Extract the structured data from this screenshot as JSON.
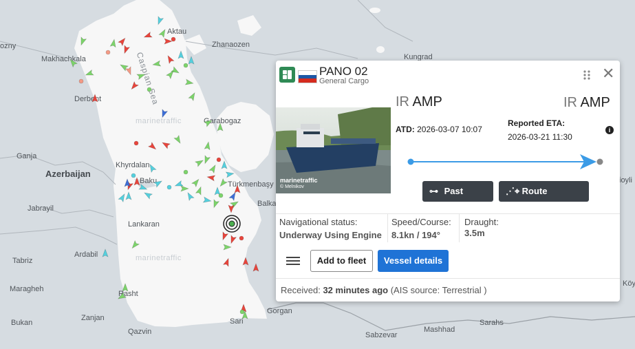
{
  "map": {
    "cities": [
      {
        "id": "aktau",
        "name": "Aktau"
      },
      {
        "id": "zhanaozen",
        "name": "Zhanaozen"
      },
      {
        "id": "kungrad",
        "name": "Kungrad"
      },
      {
        "id": "makhachkala",
        "name": "Makhachkala"
      },
      {
        "id": "derbent",
        "name": "Derbent"
      },
      {
        "id": "garabogaz",
        "name": "Garabogaz"
      },
      {
        "id": "ganja",
        "name": "Ganja"
      },
      {
        "id": "khyrdalan",
        "name": "Khyrdalan"
      },
      {
        "id": "baku",
        "name": "Baku"
      },
      {
        "id": "turkmenbasy",
        "name": "Türkmenbaşy"
      },
      {
        "id": "balkanabat",
        "name": "Balkanabat"
      },
      {
        "id": "jabrayil",
        "name": "Jabrayil"
      },
      {
        "id": "lankaran",
        "name": "Lankaran"
      },
      {
        "id": "ardabil",
        "name": "Ardabil"
      },
      {
        "id": "tabriz",
        "name": "Tabriz"
      },
      {
        "id": "maragheh",
        "name": "Maragheh"
      },
      {
        "id": "rasht",
        "name": "Rasht"
      },
      {
        "id": "gorgan",
        "name": "Gorgan"
      },
      {
        "id": "sari",
        "name": "Sari"
      },
      {
        "id": "bukan",
        "name": "Bukan"
      },
      {
        "id": "zanjan",
        "name": "Zanjan"
      },
      {
        "id": "qazvin",
        "name": "Qazvin"
      },
      {
        "id": "sabzevar",
        "name": "Sabzevar"
      },
      {
        "id": "mashhad",
        "name": "Mashhad"
      },
      {
        "id": "sarahs",
        "name": "Sarahs"
      },
      {
        "id": "ozny",
        "name": "ozny"
      },
      {
        "id": "oyli",
        "name": "ioyli"
      },
      {
        "id": "koy",
        "name": "Köy"
      }
    ],
    "countries": [
      {
        "id": "azerbaijan",
        "name": "Azerbaijan"
      }
    ],
    "sea_name": "Caspian Sea",
    "watermarks": [
      "marinetraffic",
      "marinetraffic",
      "marinetraffic"
    ]
  },
  "popup": {
    "vessel_name": "PANO 02",
    "vessel_type": "General Cargo",
    "flag_colors": [
      "#ffffff",
      "#1c57a5",
      "#d52b1e"
    ],
    "icons": {
      "vessel": "ship-category-icon",
      "drag": "drag-handle-icon",
      "close": "close-icon",
      "info": "info-icon",
      "menu": "hamburger-menu-icon",
      "track": "past-track-icon",
      "route": "route-forecast-icon"
    },
    "photo_watermark": "marinetraffic",
    "photo_credit": "© Melnikov",
    "departure": {
      "country_code": "IR",
      "port": "AMP"
    },
    "arrival": {
      "country_code": "IR",
      "port": "AMP"
    },
    "atd_label": "ATD:",
    "atd_value": "2026-03-07 10:07",
    "eta_label": "Reported ETA:",
    "eta_value": "2026-03-21 11:30",
    "progress": 1.0,
    "past_track_label": "Past track",
    "route_forecast_label": "Route forecast",
    "nav_status_label": "Navigational status:",
    "nav_status_value": "Underway Using Engine",
    "speed_label": "Speed/Course:",
    "speed_value": "8.1kn / 194°",
    "draught_label": "Draught:",
    "draught_value": "3.5m",
    "add_fleet_label": "Add to fleet",
    "details_label": "Vessel details",
    "received_label": "Received:",
    "received_value": "32 minutes ago",
    "ais_source": "(AIS source: Terrestrial )",
    "accent_color": "#1f73d6",
    "route_color": "#3b9be6"
  }
}
